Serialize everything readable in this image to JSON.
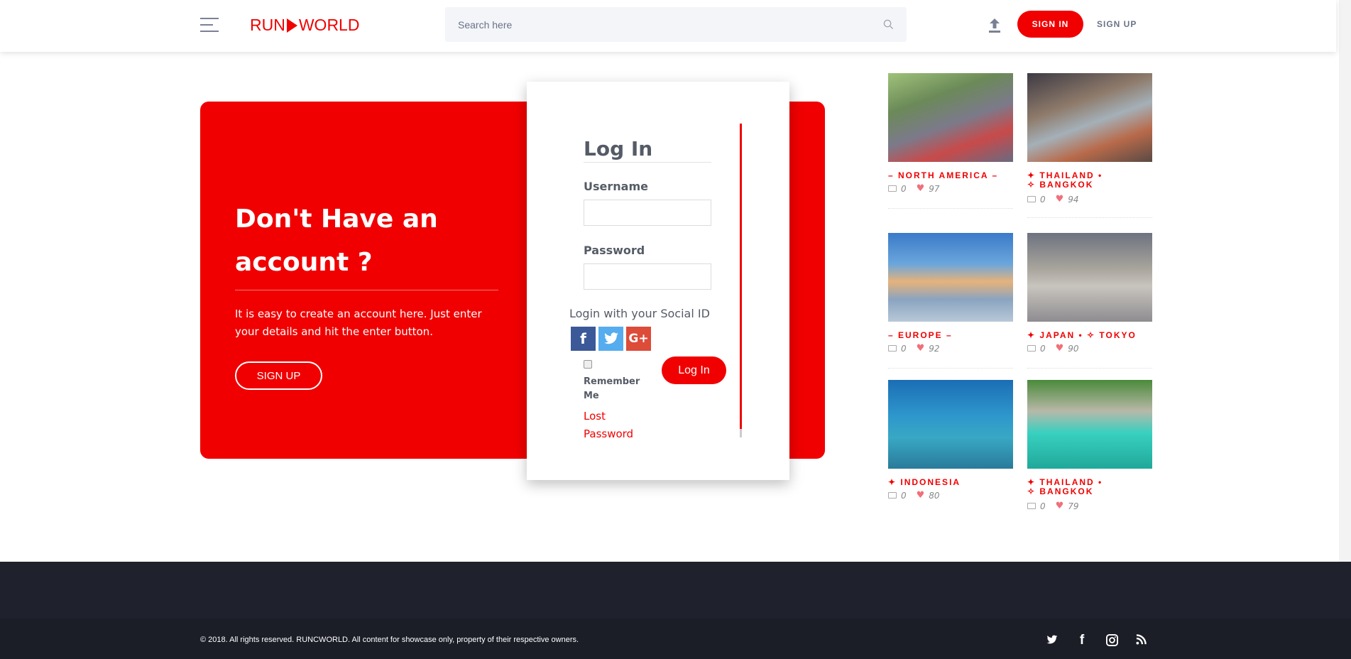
{
  "header": {
    "logo_left": "RUN",
    "logo_right": "WORLD",
    "search_placeholder": "Search here",
    "signin": "SIGN IN",
    "signup": "SIGN UP"
  },
  "promo": {
    "title": "Don't Have an account ?",
    "text": "It is easy to create an account here. Just enter your details and hit the enter button.",
    "button": "SIGN UP"
  },
  "login": {
    "title": "Log In",
    "username_label": "Username",
    "password_label": "Password",
    "social_label": "Login with your Social ID",
    "remember": "Remember Me",
    "lost_password": "Lost Password",
    "button": "Log In",
    "social": [
      "facebook",
      "twitter",
      "google-plus"
    ]
  },
  "posts": [
    {
      "title": "– NORTH AMERICA –",
      "comments": "0",
      "likes": "97"
    },
    {
      "title": "✦ THAILAND   • ✧ BANGKOK",
      "comments": "0",
      "likes": "94"
    },
    {
      "title": "– EUROPE –",
      "comments": "0",
      "likes": "92"
    },
    {
      "title": "✦ JAPAN   • ✧ TOKYO",
      "comments": "0",
      "likes": "90"
    },
    {
      "title": "✦ INDONESIA",
      "comments": "0",
      "likes": "80"
    },
    {
      "title": "✦ THAILAND   • ✧ BANGKOK",
      "comments": "0",
      "likes": "79"
    }
  ],
  "footer": {
    "copyright": "© 2018. All rights reserved. RUNCWORLD. All content for showcase only, property of their respective owners.",
    "social": [
      "twitter",
      "facebook",
      "instagram",
      "rss"
    ]
  },
  "colors": {
    "brand": "#f00000",
    "footer": "#1f222d"
  }
}
